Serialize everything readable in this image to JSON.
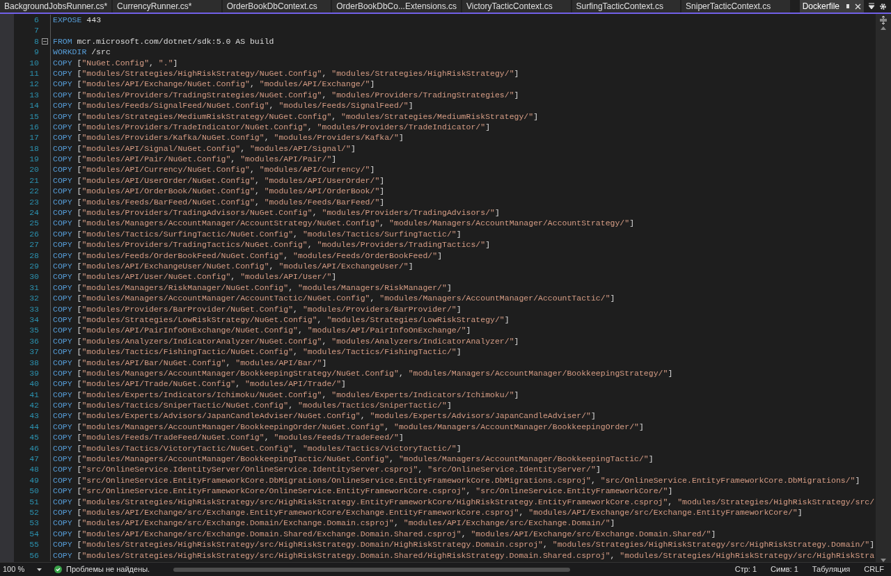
{
  "tabs": [
    {
      "label": "BackgroundJobsRunner.cs*",
      "selected": false
    },
    {
      "label": "CurrencyRunner.cs*",
      "selected": false
    },
    {
      "label": "OrderBookDbContext.cs",
      "selected": false
    },
    {
      "label": "OrderBookDbCo...Extensions.cs",
      "selected": false
    },
    {
      "label": "VictoryTacticContext.cs",
      "selected": false
    },
    {
      "label": "SurfingTacticContext.cs",
      "selected": false
    },
    {
      "label": "SniperTacticContext.cs",
      "selected": false
    },
    {
      "label": "Dockerfile",
      "selected": true
    }
  ],
  "lines": [
    {
      "number": "6",
      "keyword": "EXPOSE",
      "args": "443",
      "foldable": false
    },
    {
      "number": "7",
      "foldable": false
    },
    {
      "number": "8",
      "keyword": "FROM",
      "args": "mcr.microsoft.com/dotnet/sdk:5.0 AS build",
      "foldable": true
    },
    {
      "number": "9",
      "keyword": "WORKDIR",
      "args": "/src",
      "foldable": false
    },
    {
      "number": "10",
      "keyword": "COPY",
      "args": "[\"NuGet.Config\", \".\"]",
      "foldable": false
    },
    {
      "number": "11",
      "keyword": "COPY",
      "args": "[\"modules/Strategies/HighRiskStrategy/NuGet.Config\", \"modules/Strategies/HighRiskStrategy/\"]",
      "foldable": false
    },
    {
      "number": "12",
      "keyword": "COPY",
      "args": "[\"modules/API/Exchange/NuGet.Config\", \"modules/API/Exchange/\"]",
      "foldable": false
    },
    {
      "number": "13",
      "keyword": "COPY",
      "args": "[\"modules/Providers/TradingStrategies/NuGet.Config\", \"modules/Providers/TradingStrategies/\"]",
      "foldable": false
    },
    {
      "number": "14",
      "keyword": "COPY",
      "args": "[\"modules/Feeds/SignalFeed/NuGet.Config\", \"modules/Feeds/SignalFeed/\"]",
      "foldable": false
    },
    {
      "number": "15",
      "keyword": "COPY",
      "args": "[\"modules/Strategies/MediumRiskStrategy/NuGet.Config\", \"modules/Strategies/MediumRiskStrategy/\"]",
      "foldable": false
    },
    {
      "number": "16",
      "keyword": "COPY",
      "args": "[\"modules/Providers/TradeIndicator/NuGet.Config\", \"modules/Providers/TradeIndicator/\"]",
      "foldable": false
    },
    {
      "number": "17",
      "keyword": "COPY",
      "args": "[\"modules/Providers/Kafka/NuGet.Config\", \"modules/Providers/Kafka/\"]",
      "foldable": false
    },
    {
      "number": "18",
      "keyword": "COPY",
      "args": "[\"modules/API/Signal/NuGet.Config\", \"modules/API/Signal/\"]",
      "foldable": false
    },
    {
      "number": "19",
      "keyword": "COPY",
      "args": "[\"modules/API/Pair/NuGet.Config\", \"modules/API/Pair/\"]",
      "foldable": false
    },
    {
      "number": "20",
      "keyword": "COPY",
      "args": "[\"modules/API/Currency/NuGet.Config\", \"modules/API/Currency/\"]",
      "foldable": false
    },
    {
      "number": "21",
      "keyword": "COPY",
      "args": "[\"modules/API/UserOrder/NuGet.Config\", \"modules/API/UserOrder/\"]",
      "foldable": false
    },
    {
      "number": "22",
      "keyword": "COPY",
      "args": "[\"modules/API/OrderBook/NuGet.Config\", \"modules/API/OrderBook/\"]",
      "foldable": false
    },
    {
      "number": "23",
      "keyword": "COPY",
      "args": "[\"modules/Feeds/BarFeed/NuGet.Config\", \"modules/Feeds/BarFeed/\"]",
      "foldable": false
    },
    {
      "number": "24",
      "keyword": "COPY",
      "args": "[\"modules/Providers/TradingAdvisors/NuGet.Config\", \"modules/Providers/TradingAdvisors/\"]",
      "foldable": false
    },
    {
      "number": "25",
      "keyword": "COPY",
      "args": "[\"modules/Managers/AccountManager/AccountStrategy/NuGet.Config\", \"modules/Managers/AccountManager/AccountStrategy/\"]",
      "foldable": false
    },
    {
      "number": "26",
      "keyword": "COPY",
      "args": "[\"modules/Tactics/SurfingTactic/NuGet.Config\", \"modules/Tactics/SurfingTactic/\"]",
      "foldable": false
    },
    {
      "number": "27",
      "keyword": "COPY",
      "args": "[\"modules/Providers/TradingTactics/NuGet.Config\", \"modules/Providers/TradingTactics/\"]",
      "foldable": false
    },
    {
      "number": "28",
      "keyword": "COPY",
      "args": "[\"modules/Feeds/OrderBookFeed/NuGet.Config\", \"modules/Feeds/OrderBookFeed/\"]",
      "foldable": false
    },
    {
      "number": "29",
      "keyword": "COPY",
      "args": "[\"modules/API/ExchangeUser/NuGet.Config\", \"modules/API/ExchangeUser/\"]",
      "foldable": false
    },
    {
      "number": "30",
      "keyword": "COPY",
      "args": "[\"modules/API/User/NuGet.Config\", \"modules/API/User/\"]",
      "foldable": false
    },
    {
      "number": "31",
      "keyword": "COPY",
      "args": "[\"modules/Managers/RiskManager/NuGet.Config\", \"modules/Managers/RiskManager/\"]",
      "foldable": false
    },
    {
      "number": "32",
      "keyword": "COPY",
      "args": "[\"modules/Managers/AccountManager/AccountTactic/NuGet.Config\", \"modules/Managers/AccountManager/AccountTactic/\"]",
      "foldable": false
    },
    {
      "number": "33",
      "keyword": "COPY",
      "args": "[\"modules/Providers/BarProvider/NuGet.Config\", \"modules/Providers/BarProvider/\"]",
      "foldable": false
    },
    {
      "number": "34",
      "keyword": "COPY",
      "args": "[\"modules/Strategies/LowRiskStrategy/NuGet.Config\", \"modules/Strategies/LowRiskStrategy/\"]",
      "foldable": false
    },
    {
      "number": "35",
      "keyword": "COPY",
      "args": "[\"modules/API/PairInfoOnExchange/NuGet.Config\", \"modules/API/PairInfoOnExchange/\"]",
      "foldable": false
    },
    {
      "number": "36",
      "keyword": "COPY",
      "args": "[\"modules/Analyzers/IndicatorAnalyzer/NuGet.Config\", \"modules/Analyzers/IndicatorAnalyzer/\"]",
      "foldable": false
    },
    {
      "number": "37",
      "keyword": "COPY",
      "args": "[\"modules/Tactics/FishingTactic/NuGet.Config\", \"modules/Tactics/FishingTactic/\"]",
      "foldable": false
    },
    {
      "number": "38",
      "keyword": "COPY",
      "args": "[\"modules/API/Bar/NuGet.Config\", \"modules/API/Bar/\"]",
      "foldable": false
    },
    {
      "number": "39",
      "keyword": "COPY",
      "args": "[\"modules/Managers/AccountManager/BookkeepingStrategy/NuGet.Config\", \"modules/Managers/AccountManager/BookkeepingStrategy/\"]",
      "foldable": false
    },
    {
      "number": "40",
      "keyword": "COPY",
      "args": "[\"modules/API/Trade/NuGet.Config\", \"modules/API/Trade/\"]",
      "foldable": false
    },
    {
      "number": "41",
      "keyword": "COPY",
      "args": "[\"modules/Experts/Indicators/Ichimoku/NuGet.Config\", \"modules/Experts/Indicators/Ichimoku/\"]",
      "foldable": false
    },
    {
      "number": "42",
      "keyword": "COPY",
      "args": "[\"modules/Tactics/SniperTactic/NuGet.Config\", \"modules/Tactics/SniperTactic/\"]",
      "foldable": false
    },
    {
      "number": "43",
      "keyword": "COPY",
      "args": "[\"modules/Experts/Advisors/JapanCandleAdviser/NuGet.Config\", \"modules/Experts/Advisors/JapanCandleAdviser/\"]",
      "foldable": false
    },
    {
      "number": "44",
      "keyword": "COPY",
      "args": "[\"modules/Managers/AccountManager/BookkeepingOrder/NuGet.Config\", \"modules/Managers/AccountManager/BookkeepingOrder/\"]",
      "foldable": false
    },
    {
      "number": "45",
      "keyword": "COPY",
      "args": "[\"modules/Feeds/TradeFeed/NuGet.Config\", \"modules/Feeds/TradeFeed/\"]",
      "foldable": false
    },
    {
      "number": "46",
      "keyword": "COPY",
      "args": "[\"modules/Tactics/VictoryTactic/NuGet.Config\", \"modules/Tactics/VictoryTactic/\"]",
      "foldable": false
    },
    {
      "number": "47",
      "keyword": "COPY",
      "args": "[\"modules/Managers/AccountManager/BookkeepingTactic/NuGet.Config\", \"modules/Managers/AccountManager/BookkeepingTactic/\"]",
      "foldable": false
    },
    {
      "number": "48",
      "keyword": "COPY",
      "args": "[\"src/OnlineService.IdentityServer/OnlineService.IdentityServer.csproj\", \"src/OnlineService.IdentityServer/\"]",
      "foldable": false
    },
    {
      "number": "49",
      "keyword": "COPY",
      "args": "[\"src/OnlineService.EntityFrameworkCore.DbMigrations/OnlineService.EntityFrameworkCore.DbMigrations.csproj\", \"src/OnlineService.EntityFrameworkCore.DbMigrations/\"]",
      "foldable": false
    },
    {
      "number": "50",
      "keyword": "COPY",
      "args": "[\"src/OnlineService.EntityFrameworkCore/OnlineService.EntityFrameworkCore.csproj\", \"src/OnlineService.EntityFrameworkCore/\"]",
      "foldable": false
    },
    {
      "number": "51",
      "keyword": "COPY",
      "args": "[\"modules/Strategies/HighRiskStrategy/src/HighRiskStrategy.EntityFrameworkCore/HighRiskStrategy.EntityFrameworkCore.csproj\", \"modules/Strategies/HighRiskStrategy/src/",
      "foldable": false
    },
    {
      "number": "52",
      "keyword": "COPY",
      "args": "[\"modules/API/Exchange/src/Exchange.EntityFrameworkCore/Exchange.EntityFrameworkCore.csproj\", \"modules/API/Exchange/src/Exchange.EntityFrameworkCore/\"]",
      "foldable": false
    },
    {
      "number": "53",
      "keyword": "COPY",
      "args": "[\"modules/API/Exchange/src/Exchange.Domain/Exchange.Domain.csproj\", \"modules/API/Exchange/src/Exchange.Domain/\"]",
      "foldable": false
    },
    {
      "number": "54",
      "keyword": "COPY",
      "args": "[\"modules/API/Exchange/src/Exchange.Domain.Shared/Exchange.Domain.Shared.csproj\", \"modules/API/Exchange/src/Exchange.Domain.Shared/\"]",
      "foldable": false
    },
    {
      "number": "55",
      "keyword": "COPY",
      "args": "[\"modules/Strategies/HighRiskStrategy/src/HighRiskStrategy.Domain/HighRiskStrategy.Domain.csproj\", \"modules/Strategies/HighRiskStrategy/src/HighRiskStrategy.Domain/\"]",
      "foldable": false
    },
    {
      "number": "56",
      "keyword": "COPY",
      "args": "[\"modules/Strategies/HighRiskStrategy/src/HighRiskStrategy.Domain.Shared/HighRiskStrategy.Domain.Shared.csproj\", \"modules/Strategies/HighRiskStrategy/src/HighRiskStra",
      "foldable": false
    }
  ],
  "status_bar": {
    "zoom": "100 %",
    "issues": "Проблемы не найдены.",
    "line": "Стр: 1",
    "column": "Симв: 1",
    "indent": "Табуляция",
    "line_ending": "CRLF"
  }
}
